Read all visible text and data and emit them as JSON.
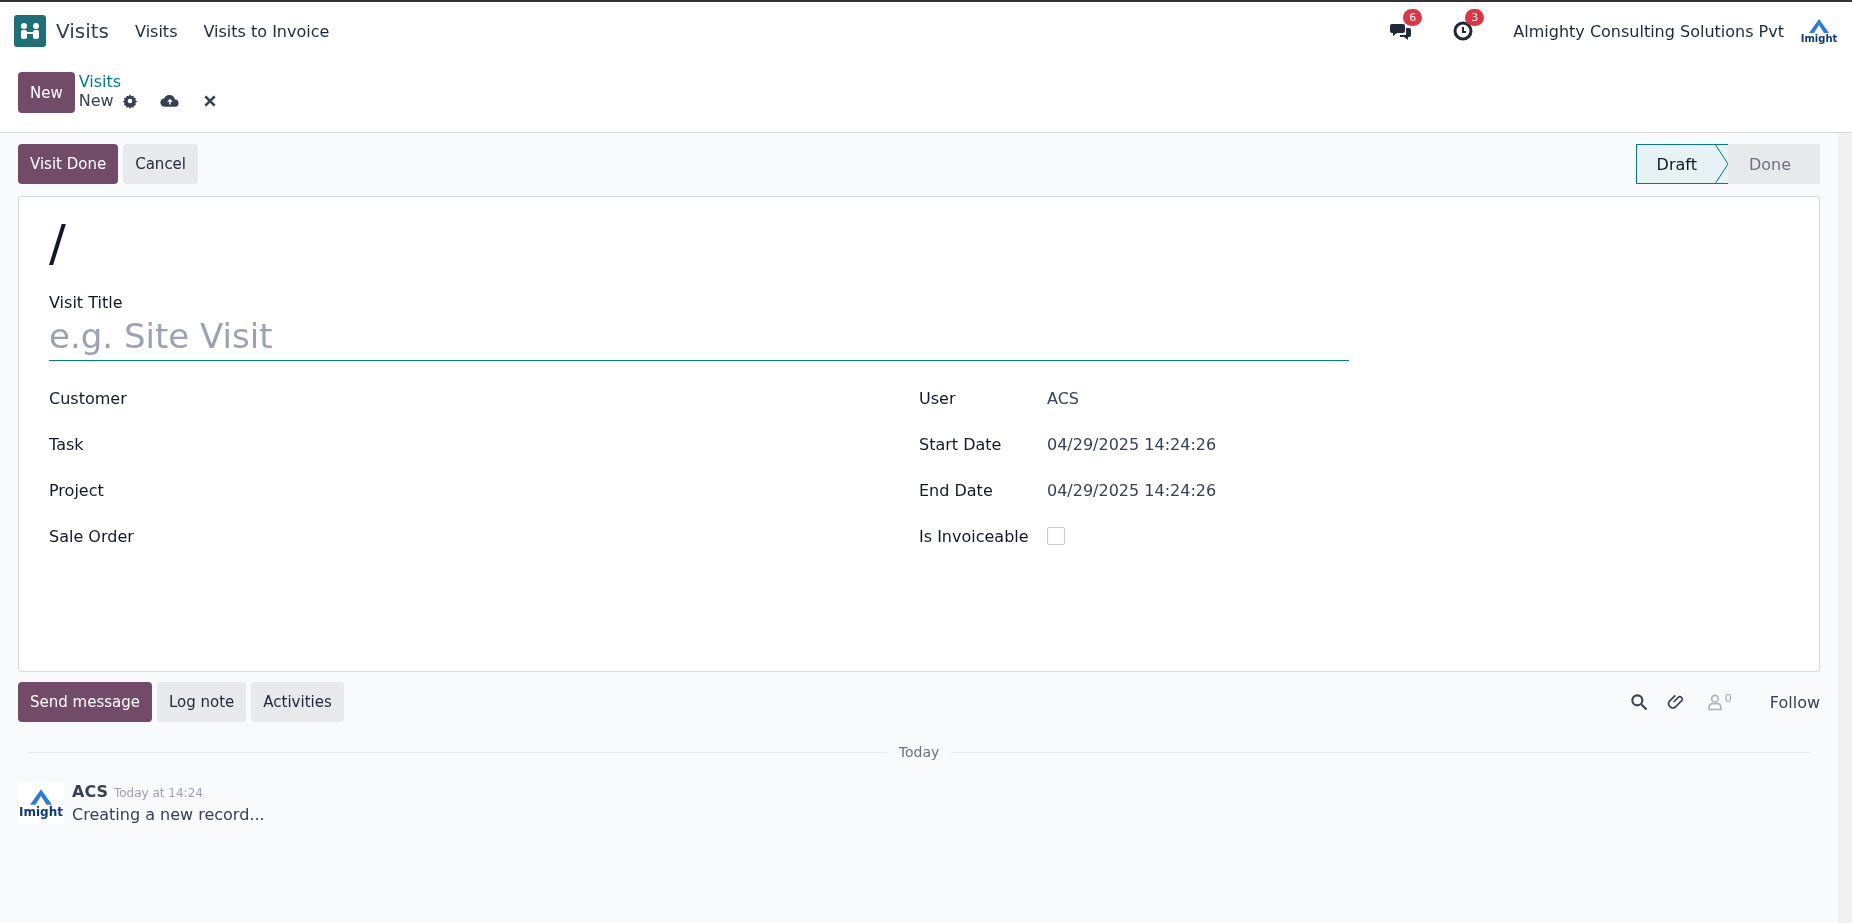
{
  "navbar": {
    "app_name": "Visits",
    "menu": [
      {
        "label": "Visits"
      },
      {
        "label": "Visits to Invoice"
      }
    ],
    "messages_badge": "6",
    "activities_badge": "3",
    "company": "Almighty Consulting Solutions Pvt",
    "company_logo_text": "Imight"
  },
  "control_panel": {
    "new_button": "New",
    "breadcrumb_parent": "Visits",
    "breadcrumb_current": "New"
  },
  "statusbar": {
    "buttons": [
      {
        "label": "Visit Done",
        "primary": true
      },
      {
        "label": "Cancel",
        "primary": false
      }
    ],
    "stages": [
      {
        "label": "Draft",
        "selected": true
      },
      {
        "label": "Done",
        "selected": false
      }
    ]
  },
  "form": {
    "record_name": "/",
    "title_label": "Visit Title",
    "title_placeholder": "e.g. Site Visit",
    "left_fields": [
      {
        "label": "Customer"
      },
      {
        "label": "Task"
      },
      {
        "label": "Project"
      },
      {
        "label": "Sale Order"
      }
    ],
    "right_fields": [
      {
        "kind": "text",
        "label": "User",
        "value": "ACS"
      },
      {
        "kind": "text",
        "label": "Start Date",
        "value": "04/29/2025 14:24:26"
      },
      {
        "kind": "text",
        "label": "End Date",
        "value": "04/29/2025 14:24:26"
      },
      {
        "kind": "checkbox",
        "label": "Is Invoiceable",
        "checked": false
      }
    ]
  },
  "chatter": {
    "buttons": [
      {
        "label": "Send message",
        "primary": true
      },
      {
        "label": "Log note",
        "primary": false
      },
      {
        "label": "Activities",
        "primary": false
      }
    ],
    "followers_count": "0",
    "follow": "Follow",
    "date_separator": "Today",
    "messages": [
      {
        "author": "ACS",
        "time": "Today at 14:24",
        "body": "Creating a new record...",
        "avatar_text": "Imight"
      }
    ]
  }
}
